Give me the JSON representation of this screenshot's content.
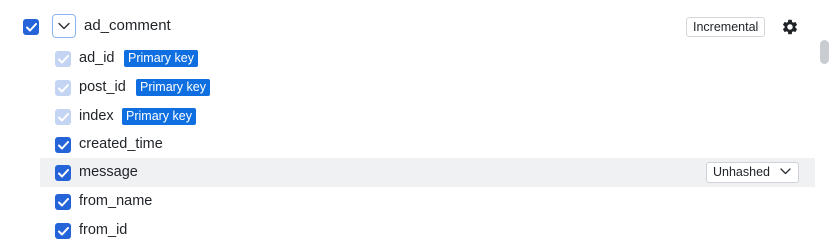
{
  "table": {
    "name": "ad_comment",
    "selected": true,
    "expanded": true,
    "sync_mode": "Incremental",
    "settings_icon": "gear-icon",
    "expand_icon": "chevron-down-icon"
  },
  "columns": [
    {
      "name": "ad_id",
      "badge": "Primary key",
      "checked": true,
      "locked": true
    },
    {
      "name": "post_id",
      "badge": "Primary key",
      "checked": true,
      "locked": true
    },
    {
      "name": "index",
      "badge": "Primary key",
      "checked": true,
      "locked": true
    },
    {
      "name": "created_time",
      "checked": true,
      "locked": false
    },
    {
      "name": "message",
      "checked": true,
      "locked": false,
      "hovered": true,
      "hash_option": "Unhashed"
    },
    {
      "name": "from_name",
      "checked": true,
      "locked": false
    },
    {
      "name": "from_id",
      "checked": true,
      "locked": false
    }
  ],
  "colors": {
    "checkbox": "#2563d9",
    "checkbox_locked": "#c3d5f3",
    "primary_key_badge": "#0f6fe0",
    "row_highlight": "#f0f1f3"
  }
}
